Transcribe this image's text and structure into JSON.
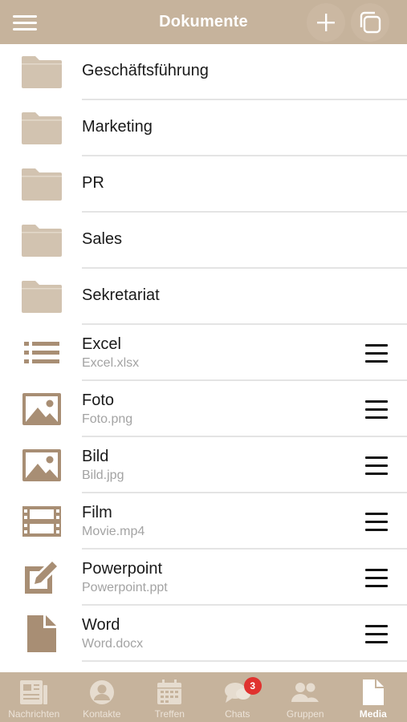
{
  "header": {
    "title": "Dokumente",
    "menu_icon": "hamburger-icon",
    "add_icon": "plus-icon",
    "copy_icon": "copy-icon",
    "background_color": "#c6b39c"
  },
  "folders": [
    {
      "label": "Geschäftsführung",
      "icon": "folder-icon"
    },
    {
      "label": "Marketing",
      "icon": "folder-icon"
    },
    {
      "label": "PR",
      "icon": "folder-icon"
    },
    {
      "label": "Sales",
      "icon": "folder-icon"
    },
    {
      "label": "Sekretariat",
      "icon": "folder-icon"
    }
  ],
  "files": [
    {
      "label": "Excel",
      "filename": "Excel.xlsx",
      "icon": "list-icon"
    },
    {
      "label": "Foto",
      "filename": "Foto.png",
      "icon": "image-icon"
    },
    {
      "label": "Bild",
      "filename": "Bild.jpg",
      "icon": "image-icon"
    },
    {
      "label": "Film",
      "filename": "Movie.mp4",
      "icon": "film-icon"
    },
    {
      "label": "Powerpoint",
      "filename": "Powerpoint.ppt",
      "icon": "edit-icon"
    },
    {
      "label": "Word",
      "filename": "Word.docx",
      "icon": "document-icon"
    }
  ],
  "tabbar": {
    "tabs": [
      {
        "label": "Nachrichten",
        "icon": "newspaper-icon"
      },
      {
        "label": "Kontakte",
        "icon": "person-icon"
      },
      {
        "label": "Treffen",
        "icon": "calendar-icon"
      },
      {
        "label": "Chats",
        "icon": "chat-icon",
        "badge": "3"
      },
      {
        "label": "Gruppen",
        "icon": "group-icon"
      },
      {
        "label": "Media",
        "icon": "document-icon",
        "active": true
      }
    ]
  },
  "colors": {
    "accent": "#c6b39c",
    "folder": "#d2c3b0",
    "file_icon": "#a88e74",
    "badge": "#e0322f"
  }
}
